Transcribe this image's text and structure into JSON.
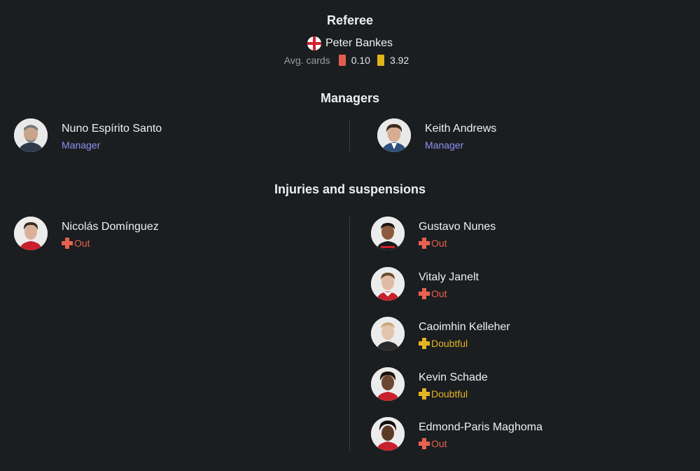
{
  "referee": {
    "section_title": "Referee",
    "name": "Peter Bankes",
    "flag_icon": "england-flag-icon",
    "avg_cards_label": "Avg. cards",
    "red_cards": "0.10",
    "yellow_cards": "3.92"
  },
  "managers": {
    "section_title": "Managers",
    "home": {
      "name": "Nuno Espírito Santo",
      "role": "Manager"
    },
    "away": {
      "name": "Keith Andrews",
      "role": "Manager"
    }
  },
  "injuries": {
    "section_title": "Injuries and suspensions",
    "home": [
      {
        "name": "Nicolás Domínguez",
        "status": "Out"
      }
    ],
    "away": [
      {
        "name": "Gustavo Nunes",
        "status": "Out"
      },
      {
        "name": "Vitaly Janelt",
        "status": "Out"
      },
      {
        "name": "Caoimhin Kelleher",
        "status": "Doubtful"
      },
      {
        "name": "Kevin Schade",
        "status": "Doubtful"
      },
      {
        "name": "Edmond-Paris Maghoma",
        "status": "Out"
      }
    ]
  },
  "colors": {
    "background": "#1b1e20",
    "manager_role": "#8d92f2",
    "status_out": "#e8604f",
    "status_doubtful": "#e4b422",
    "red_card": "#e35d4f",
    "yellow_card": "#e3b51b"
  }
}
